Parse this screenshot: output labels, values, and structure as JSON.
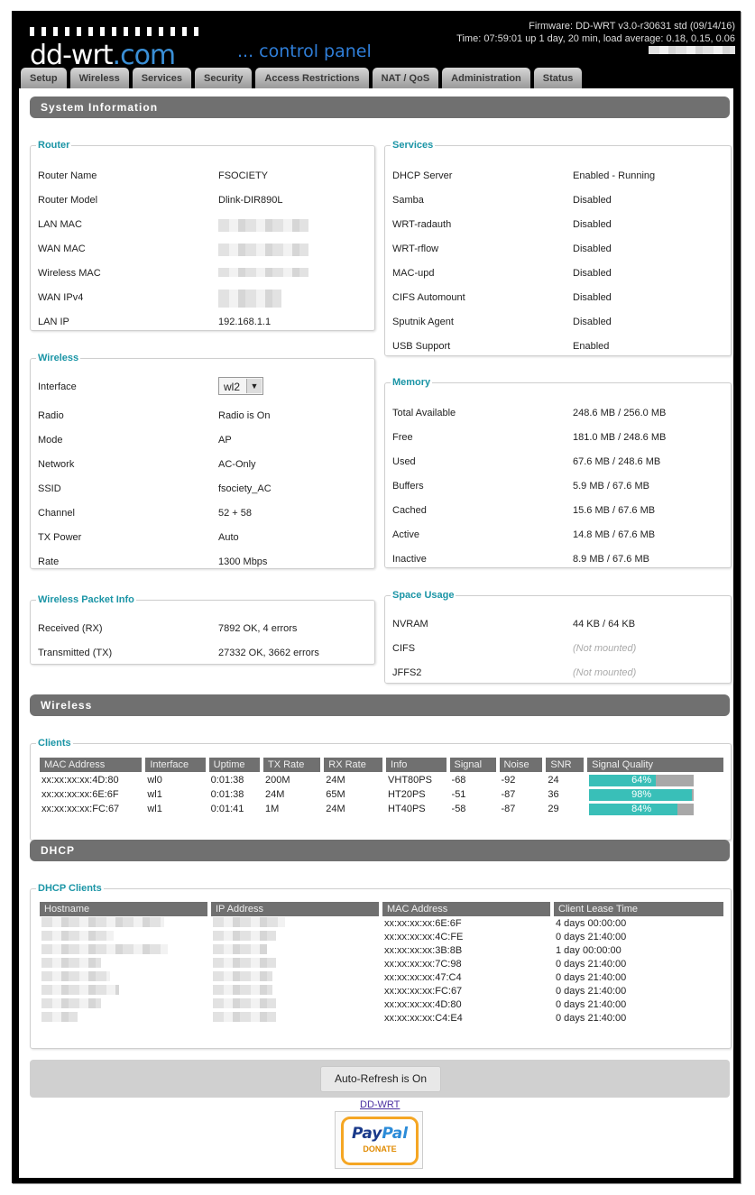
{
  "header": {
    "logo_main": "dd-wrt",
    "logo_com": ".com",
    "tagline": "... control panel",
    "firmware": "Firmware: DD-WRT v3.0-r30631 std (09/14/16)",
    "time": "Time: 07:59:01 up 1 day, 20 min, load average: 0.18, 0.15, 0.06"
  },
  "tabs": [
    "Setup",
    "Wireless",
    "Services",
    "Security",
    "Access Restrictions",
    "NAT / QoS",
    "Administration",
    "Status"
  ],
  "sections": {
    "system_info": "System Information",
    "wireless": "Wireless",
    "dhcp": "DHCP"
  },
  "router": {
    "legend": "Router",
    "rows": [
      {
        "k": "Router Name",
        "v": "FSOCIETY"
      },
      {
        "k": "Router Model",
        "v": "Dlink-DIR890L"
      },
      {
        "k": "LAN MAC",
        "v": ""
      },
      {
        "k": "WAN MAC",
        "v": ""
      },
      {
        "k": "Wireless MAC",
        "v": ""
      },
      {
        "k": "WAN IPv4",
        "v": ""
      },
      {
        "k": "LAN IP",
        "v": "192.168.1.1"
      }
    ]
  },
  "wireless_info": {
    "legend": "Wireless",
    "interface_label": "Interface",
    "interface_value": "wl2",
    "rows": [
      {
        "k": "Radio",
        "v": "Radio is On"
      },
      {
        "k": "Mode",
        "v": "AP"
      },
      {
        "k": "Network",
        "v": "AC-Only"
      },
      {
        "k": "SSID",
        "v": "fsociety_AC"
      },
      {
        "k": "Channel",
        "v": "52 + 58"
      },
      {
        "k": "TX Power",
        "v": "Auto"
      },
      {
        "k": "Rate",
        "v": "1300 Mbps"
      }
    ]
  },
  "packet_info": {
    "legend": "Wireless Packet Info",
    "rows": [
      {
        "k": "Received (RX)",
        "v": "7892 OK, 4 errors"
      },
      {
        "k": "Transmitted (TX)",
        "v": "27332 OK, 3662 errors"
      }
    ]
  },
  "services": {
    "legend": "Services",
    "rows": [
      {
        "k": "DHCP Server",
        "v": "Enabled - Running"
      },
      {
        "k": "Samba",
        "v": "Disabled"
      },
      {
        "k": "WRT-radauth",
        "v": "Disabled"
      },
      {
        "k": "WRT-rflow",
        "v": "Disabled"
      },
      {
        "k": "MAC-upd",
        "v": "Disabled"
      },
      {
        "k": "CIFS Automount",
        "v": "Disabled"
      },
      {
        "k": "Sputnik Agent",
        "v": "Disabled"
      },
      {
        "k": "USB Support",
        "v": "Enabled"
      }
    ]
  },
  "memory": {
    "legend": "Memory",
    "rows": [
      {
        "k": "Total Available",
        "v": "248.6 MB / 256.0 MB"
      },
      {
        "k": "Free",
        "v": "181.0 MB / 248.6 MB"
      },
      {
        "k": "Used",
        "v": "67.6 MB / 248.6 MB"
      },
      {
        "k": "Buffers",
        "v": "5.9 MB / 67.6 MB"
      },
      {
        "k": "Cached",
        "v": "15.6 MB / 67.6 MB"
      },
      {
        "k": "Active",
        "v": "14.8 MB / 67.6 MB"
      },
      {
        "k": "Inactive",
        "v": "8.9 MB / 67.6 MB"
      }
    ]
  },
  "space": {
    "legend": "Space Usage",
    "rows": [
      {
        "k": "NVRAM",
        "v": "44 KB / 64 KB"
      },
      {
        "k": "CIFS",
        "v": "(Not mounted)"
      },
      {
        "k": "JFFS2",
        "v": "(Not mounted)"
      }
    ]
  },
  "clients": {
    "legend": "Clients",
    "headers": [
      "MAC Address",
      "Interface",
      "Uptime",
      "TX Rate",
      "RX Rate",
      "Info",
      "Signal",
      "Noise",
      "SNR",
      "Signal Quality"
    ],
    "rows": [
      {
        "mac": "xx:xx:xx:xx:4D:80",
        "iface": "wl0",
        "uptime": "0:01:38",
        "tx": "200M",
        "rx": "24M",
        "info": "VHT80PS",
        "signal": "-68",
        "noise": "-92",
        "snr": "24",
        "quality": "64%"
      },
      {
        "mac": "xx:xx:xx:xx:6E:6F",
        "iface": "wl1",
        "uptime": "0:01:38",
        "tx": "24M",
        "rx": "65M",
        "info": "HT20PS",
        "signal": "-51",
        "noise": "-87",
        "snr": "36",
        "quality": "98%"
      },
      {
        "mac": "xx:xx:xx:xx:FC:67",
        "iface": "wl1",
        "uptime": "0:01:41",
        "tx": "1M",
        "rx": "24M",
        "info": "HT40PS",
        "signal": "-58",
        "noise": "-87",
        "snr": "29",
        "quality": "84%"
      }
    ]
  },
  "dhcp_clients": {
    "legend": "DHCP Clients",
    "headers": [
      "Hostname",
      "IP Address",
      "MAC Address",
      "Client Lease Time"
    ],
    "rows": [
      {
        "mac": "xx:xx:xx:xx:6E:6F",
        "lease": "4 days 00:00:00"
      },
      {
        "mac": "xx:xx:xx:xx:4C:FE",
        "lease": "0 days 21:40:00"
      },
      {
        "mac": "xx:xx:xx:xx:3B:8B",
        "lease": "1 day 00:00:00"
      },
      {
        "mac": "xx:xx:xx:xx:7C:98",
        "lease": "0 days 21:40:00"
      },
      {
        "mac": "xx:xx:xx:xx:47:C4",
        "lease": "0 days 21:40:00"
      },
      {
        "mac": "xx:xx:xx:xx:FC:67",
        "lease": "0 days 21:40:00"
      },
      {
        "mac": "xx:xx:xx:xx:4D:80",
        "lease": "0 days 21:40:00"
      },
      {
        "mac": "xx:xx:xx:xx:C4:E4",
        "lease": "0 days 21:40:00"
      }
    ]
  },
  "footer": {
    "refresh": "Auto-Refresh is On",
    "link": "DD-WRT",
    "paypal_pay": "Pay",
    "paypal_pal": "Pal",
    "paypal_donate": "DONATE"
  },
  "colors": {
    "accent": "#1b95a6",
    "bar_fill": "#39bfb8",
    "section_bg": "#707070"
  }
}
